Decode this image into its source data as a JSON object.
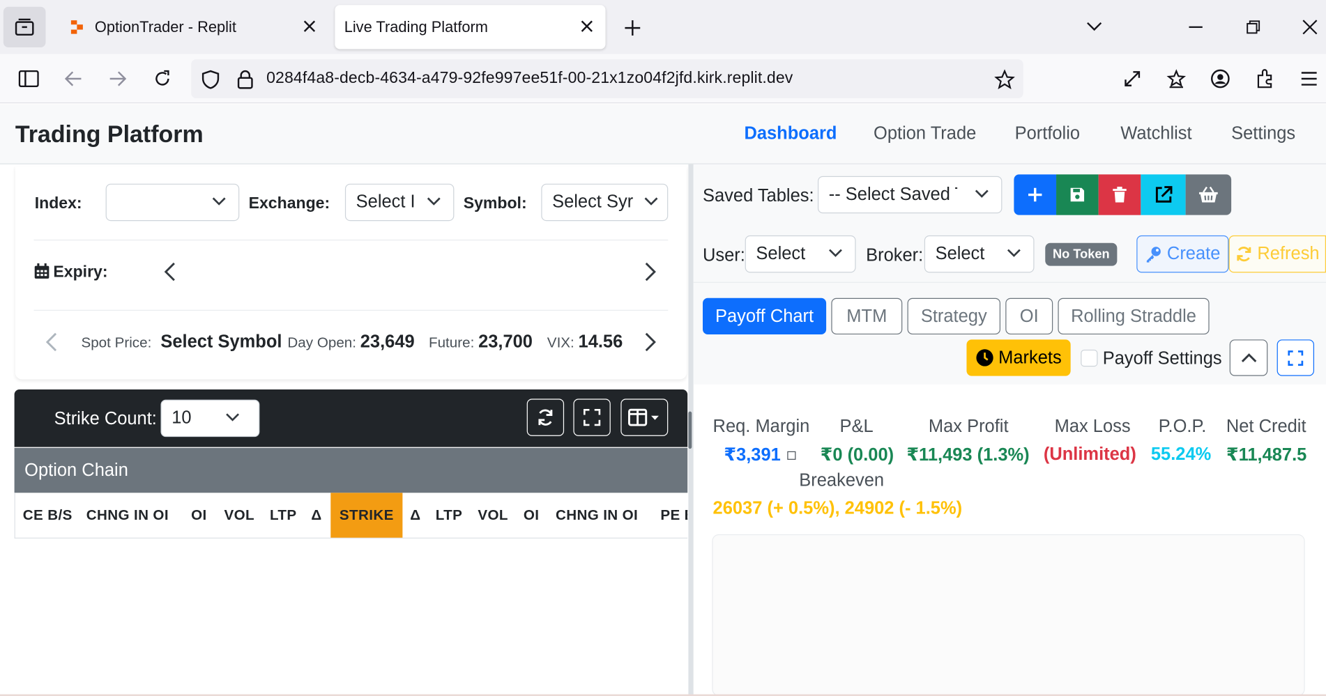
{
  "browser": {
    "tabs": [
      {
        "title": "OptionTrader - Replit"
      },
      {
        "title": "Live Trading Platform"
      }
    ],
    "url": "0284f4a8-decb-4634-a479-92fe997ee51f-00-21x1zo04f2jfd.kirk.replit.dev"
  },
  "app": {
    "brand": "Trading Platform",
    "nav": [
      "Dashboard",
      "Option Trade",
      "Portfolio",
      "Watchlist",
      "Settings"
    ],
    "active_nav": "Dashboard"
  },
  "left": {
    "index_label": "Index:",
    "index_value": "",
    "exchange_label": "Exchange:",
    "exchange_value": "Select I",
    "symbol_label": "Symbol:",
    "symbol_value": "Select Syr",
    "expiry_label": "Expiry:",
    "spot_label": "Spot Price:",
    "spot_value": "Select Symbol",
    "day_open_label": "Day Open:",
    "day_open_value": "23,649",
    "future_label": "Future:",
    "future_value": "23,700",
    "vix_label": "VIX:",
    "vix_value": "14.56",
    "strike_count_label": "Strike Count:",
    "strike_count_value": "10",
    "option_chain_title": "Option Chain",
    "columns": [
      "CE B/S",
      "CHNG IN OI",
      "OI",
      "VOL",
      "LTP",
      "Δ",
      "STRIKE",
      "Δ",
      "LTP",
      "VOL",
      "OI",
      "CHNG IN OI",
      "PE B"
    ]
  },
  "right": {
    "saved_tables_label": "Saved Tables:",
    "saved_tables_value": "-- Select Saved Ta",
    "user_label": "User:",
    "user_value": "Select",
    "broker_label": "Broker:",
    "broker_value": "Select",
    "token_badge": "No Token",
    "create_label": "Create",
    "refresh_label": "Refresh",
    "tabs": [
      "Payoff Chart",
      "MTM",
      "Strategy",
      "OI",
      "Rolling Straddle"
    ],
    "active_tab": "Payoff Chart",
    "markets_label": "Markets",
    "payoff_settings_label": "Payoff Settings",
    "stats": {
      "req_margin_label": "Req. Margin",
      "req_margin_value": "₹3,391",
      "pnl_label": "P&L",
      "pnl_value": "₹0 (0.00)",
      "max_profit_label": "Max Profit",
      "max_profit_value": "₹11,493 (1.3%)",
      "max_loss_label": "Max Loss",
      "max_loss_value": "(Unlimited)",
      "pop_label": "P.O.P.",
      "pop_value": "55.24%",
      "net_credit_label": "Net Credit",
      "net_credit_value": "₹11,487.5",
      "breakeven_label": "Breakeven",
      "breakeven_value": "26037 (+ 0.5%), 24902 (- 1.5%)"
    }
  },
  "colors": {
    "primary": "#0d6efd",
    "success": "#198754",
    "danger": "#dc3545",
    "info": "#0dcaf0",
    "warning": "#ffc107",
    "secondary": "#6c757d",
    "strike_header": "#f39c12",
    "dark": "#212529"
  }
}
